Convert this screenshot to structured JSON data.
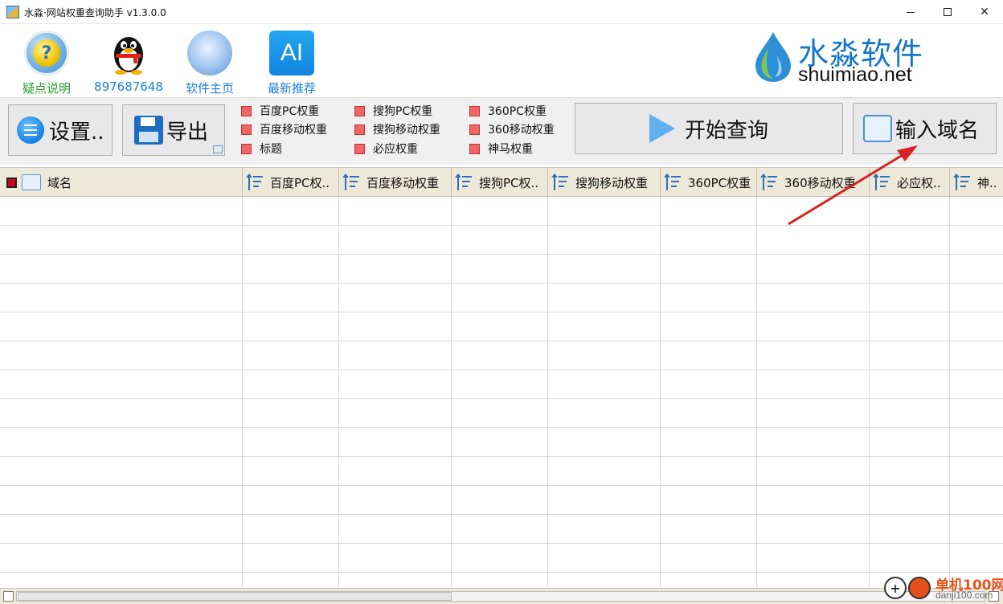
{
  "window": {
    "title": "水淼·网站权重查询助手 v1.3.0.0"
  },
  "top_links": [
    {
      "label": "疑点说明",
      "color": "#2a9d2a",
      "icon": "help-icon"
    },
    {
      "label": "897687648",
      "color": "#1f7fd6",
      "icon": "qq-penguin-icon"
    },
    {
      "label": "软件主页",
      "color": "#1f7fd6",
      "icon": "globe-icon"
    },
    {
      "label": "最新推荐",
      "color": "#1f7fd6",
      "icon": "ai-icon",
      "icon_text": "AI"
    }
  ],
  "logo": {
    "cn": "水淼软件",
    "en": "shuimiao.net"
  },
  "toolbar": {
    "settings_label": "设置..",
    "export_label": "导出",
    "start_label": "开始查询",
    "input_label": "输入域名"
  },
  "options": [
    {
      "label": "百度PC权重",
      "checked_color": "#f26565"
    },
    {
      "label": "百度移动权重",
      "checked_color": "#f26565"
    },
    {
      "label": "标题",
      "checked_color": "#f26565"
    },
    {
      "label": "搜狗PC权重",
      "checked_color": "#f26565"
    },
    {
      "label": "搜狗移动权重",
      "checked_color": "#f26565"
    },
    {
      "label": "必应权重",
      "checked_color": "#f26565"
    },
    {
      "label": "360PC权重",
      "checked_color": "#f26565"
    },
    {
      "label": "360移动权重",
      "checked_color": "#f26565"
    },
    {
      "label": "神马权重",
      "checked_color": "#f26565"
    }
  ],
  "table": {
    "columns": [
      "域名",
      "百度PC权..",
      "百度移动权重",
      "搜狗PC权..",
      "搜狗移动权重",
      "360PC权重",
      "360移动权重",
      "必应权..",
      "神.."
    ],
    "rows": []
  },
  "watermark": {
    "text": "单机100网",
    "url": "danji100.com"
  }
}
